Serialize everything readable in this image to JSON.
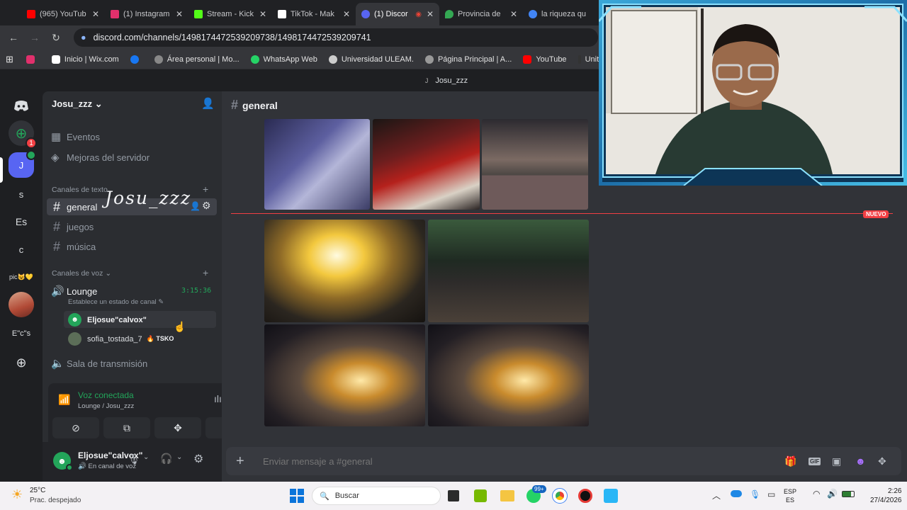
{
  "browser": {
    "tabs": [
      {
        "title": "(965) YouTub",
        "color": "#ff0000"
      },
      {
        "title": "(1) Instagram",
        "color": "#e1306c"
      },
      {
        "title": "Stream - Kick",
        "color": "#53fc18"
      },
      {
        "title": "TikTok - Mak",
        "color": "#ffffff"
      },
      {
        "title": "(1) Discor",
        "color": "#5865f2"
      },
      {
        "title": "Provincia de",
        "color": "#34a853"
      },
      {
        "title": "la riqueza qu",
        "color": "#4285f4"
      }
    ],
    "url": "discord.com/channels/1498174472539209738/1498174472539209741",
    "bookmarks": [
      {
        "label": "Inicio | Wix.com",
        "color": "#ffffff"
      },
      {
        "label": "Área personal | Mo...",
        "color": "#888888"
      },
      {
        "label": "WhatsApp Web",
        "color": "#25d366"
      },
      {
        "label": "Universidad ULEAM.",
        "color": "#cccccc"
      },
      {
        "label": "Página Principal | A...",
        "color": "#999999"
      },
      {
        "label": "YouTube",
        "color": "#ff0000"
      },
      {
        "label": "Unitips | Cursos pa",
        "color": "#333333"
      }
    ]
  },
  "discord": {
    "window_title": "Josu_zzz",
    "window_icon": "J",
    "guilds": [
      "J",
      "s",
      "Es",
      "c",
      "pic😺💛",
      "E\"c\"s"
    ],
    "server_name": "Josu_zzz",
    "items": {
      "events": "Eventos",
      "boosts": "Mejoras del servidor"
    },
    "text_header": "Canales de texto",
    "overlay_handwriting": "Josu_zzz",
    "text_channels": [
      "general",
      "juegos",
      "música"
    ],
    "voice_header": "Canales de voz",
    "voice_channel": {
      "name": "Lounge",
      "timer": "3:15:36",
      "status": "Establece un estado de canal"
    },
    "voice_users": [
      {
        "name": "Eljosue\"calvox\"",
        "tag": ""
      },
      {
        "name": "sofia_tostada_7",
        "tag": "TSKO"
      }
    ],
    "stage_channel": "Sala de transmisión",
    "voice_panel": {
      "status": "Voz conectada",
      "location": "Lounge / Josu_zzz"
    },
    "user": {
      "name": "Eljosue\"calvox\"",
      "status": "En canal de voz"
    },
    "channel_header": "general",
    "new_badge": "NUEVO",
    "composer_placeholder": "Enviar mensaje a #general",
    "guild_badge": "1"
  },
  "taskbar": {
    "weather_temp": "25°C",
    "weather_desc": "Prac. despejado",
    "search": "Buscar",
    "whatsapp_badge": "99+",
    "lang1": "ESP",
    "lang2": "ES",
    "time": "2:26",
    "date": "27/4/2026"
  }
}
